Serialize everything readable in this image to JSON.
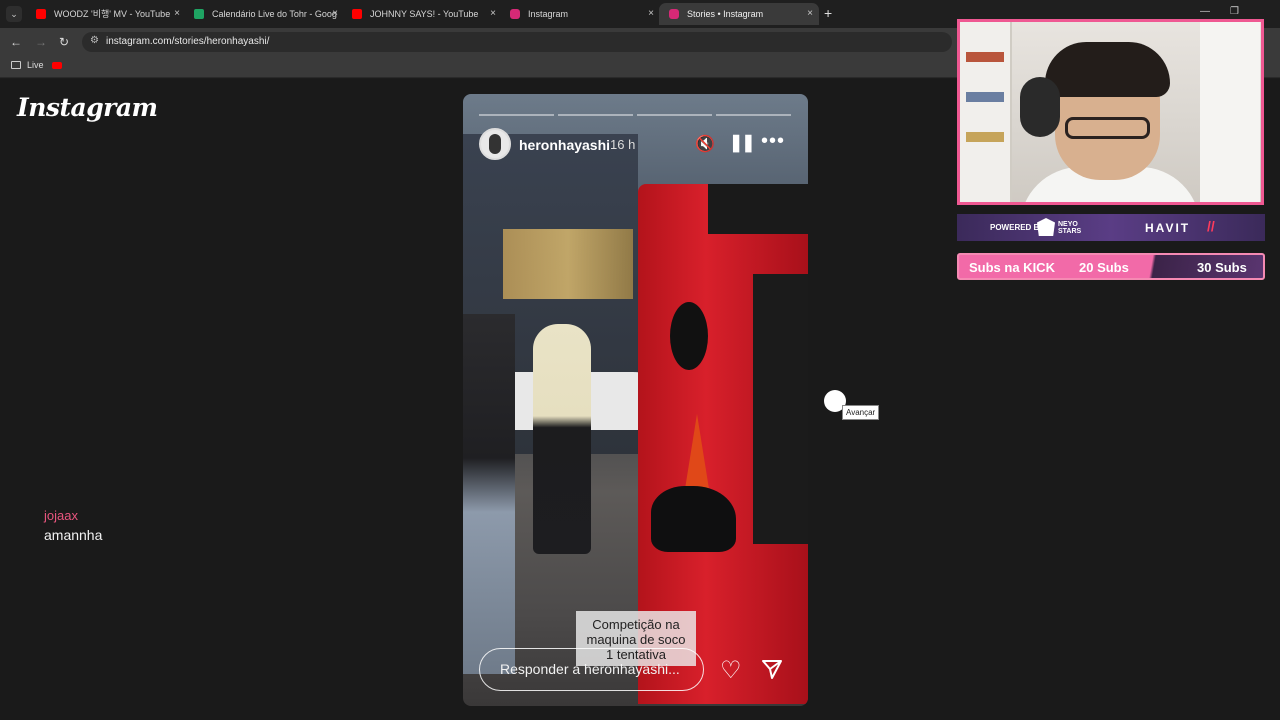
{
  "browser": {
    "tabs": [
      {
        "title": "WOODZ '비행' MV - YouTube",
        "favicon": "youtube-icon",
        "color": "#ff0000"
      },
      {
        "title": "Calendário Live do Tohr - Goog",
        "favicon": "sheets-icon",
        "color": "#1fa463"
      },
      {
        "title": "JOHNNY SAYS! - YouTube",
        "favicon": "youtube-icon",
        "color": "#ff0000"
      },
      {
        "title": "Instagram",
        "favicon": "instagram-icon",
        "color": "#d62976"
      },
      {
        "title": "Stories • Instagram",
        "favicon": "instagram-icon",
        "color": "#d62976"
      }
    ],
    "url": "instagram.com/stories/heronhayashi/",
    "bookmarks": [
      {
        "label": "Live"
      }
    ],
    "new_tab": "+",
    "close_glyph": "×"
  },
  "instagram": {
    "logo": "Instagram",
    "story": {
      "username": "heronhayashi",
      "time": "16 h",
      "caption": [
        "Competição na",
        "maquina de soco",
        "1 tentativa"
      ],
      "reply_placeholder": "Responder a heronhayashi...",
      "tooltip": "Avançar"
    }
  },
  "stream_overlay": {
    "chat_user": "jojaax",
    "chat_message": "amannha",
    "powered_by": "POWERED BY",
    "sponsor_1": [
      "NEYO",
      "STARS"
    ],
    "sponsor_2": "HAVIT",
    "subs_label": "Subs na KICK",
    "subs_current": "20 Subs",
    "subs_goal": "30 Subs",
    "accent_color": "#f26aa8"
  }
}
